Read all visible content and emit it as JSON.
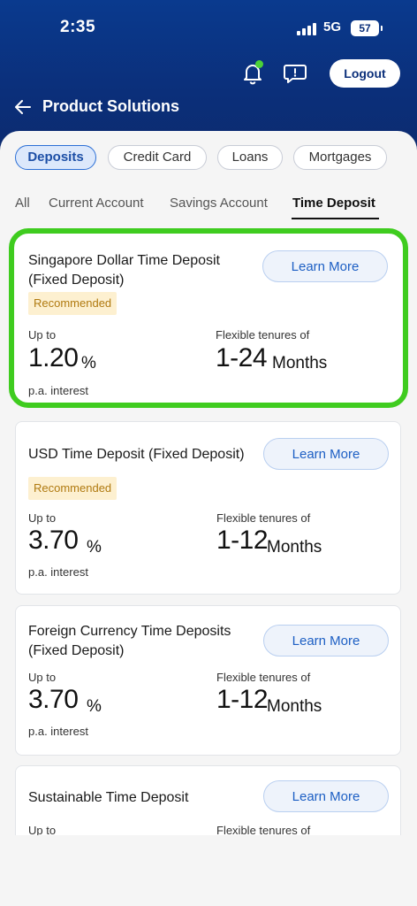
{
  "status_bar": {
    "time": "2:35",
    "network": "5G",
    "battery": "57"
  },
  "header": {
    "logout_label": "Logout",
    "title": "Product Solutions"
  },
  "chips": [
    {
      "label": "Deposits"
    },
    {
      "label": "Credit Card"
    },
    {
      "label": "Loans"
    },
    {
      "label": "Mortgages"
    }
  ],
  "tabs": [
    {
      "label": "All"
    },
    {
      "label": "Current Account"
    },
    {
      "label": "Savings Account"
    },
    {
      "label": "Time Deposit"
    }
  ],
  "cards": [
    {
      "title_line1": "Singapore Dollar Time Deposit",
      "title_line2": "(Fixed Deposit)",
      "button": "Learn More",
      "badge": "Recommended",
      "rate_label": "Up to",
      "rate": "1.20",
      "rate_unit": "%",
      "rate_note": "p.a. interest",
      "tenure_label": "Flexible tenures of",
      "tenure": "1-24",
      "tenure_unit": "Months"
    },
    {
      "title_line1": "USD Time Deposit (Fixed Deposit)",
      "button": "Learn More",
      "badge": "Recommended",
      "rate_label": "Up to",
      "rate": "3.70",
      "rate_unit": "%",
      "rate_note": "p.a. interest",
      "tenure_label": "Flexible tenures of",
      "tenure": "1-12",
      "tenure_unit": "Months"
    },
    {
      "title_line1": "Foreign Currency Time Deposits",
      "title_line2": "(Fixed Deposit)",
      "button": "Learn More",
      "rate_label": "Up to",
      "rate": "3.70",
      "rate_unit": "%",
      "rate_note": "p.a. interest",
      "tenure_label": "Flexible tenures of",
      "tenure": "1-12",
      "tenure_unit": "Months"
    },
    {
      "title_line1": "Sustainable Time Deposit",
      "button": "Learn More",
      "rate_label": "Up to",
      "tenure_label": "Flexible tenures of"
    }
  ],
  "colors": {
    "header_bg": "#0b2f7a",
    "highlight": "#3fcc1f",
    "accent": "#1d5fc4",
    "badge_bg": "#fdf0d0"
  }
}
